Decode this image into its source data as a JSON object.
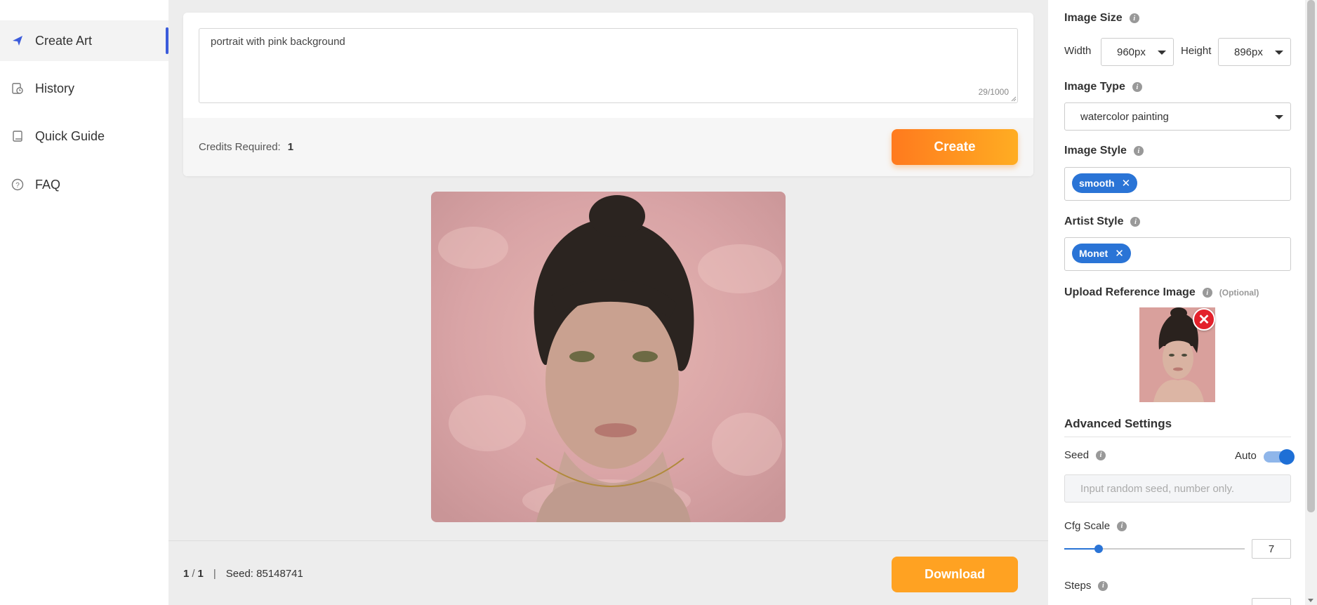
{
  "sidebar": {
    "items": [
      {
        "label": "Create Art",
        "icon": "send-icon",
        "active": true
      },
      {
        "label": "History",
        "icon": "history-icon"
      },
      {
        "label": "Quick Guide",
        "icon": "book-icon"
      },
      {
        "label": "FAQ",
        "icon": "question-icon"
      }
    ]
  },
  "prompt": {
    "value": "portrait with pink background",
    "counter": "29/1000"
  },
  "credits": {
    "label": "Credits Required:",
    "value": "1"
  },
  "create_label": "Create",
  "result": {
    "page_current": "1",
    "page_sep": "/",
    "page_total": "1",
    "divider": "|",
    "seed_text": "Seed: 85148741"
  },
  "download_label": "Download",
  "settings": {
    "image_size": {
      "label": "Image Size",
      "width_label": "Width",
      "width_value": "960px",
      "height_label": "Height",
      "height_value": "896px"
    },
    "image_type": {
      "label": "Image Type",
      "value": "watercolor painting"
    },
    "image_style": {
      "label": "Image Style",
      "tags": [
        "smooth"
      ]
    },
    "artist_style": {
      "label": "Artist Style",
      "tags": [
        "Monet"
      ]
    },
    "upload": {
      "label": "Upload Reference Image",
      "optional": "(Optional)"
    },
    "advanced": {
      "title": "Advanced Settings",
      "seed_label": "Seed",
      "auto_label": "Auto",
      "auto_on": true,
      "seed_placeholder": "Input random seed, number only.",
      "cfg_label": "Cfg Scale",
      "cfg_value": "7",
      "cfg_fraction": 0.19,
      "steps_label": "Steps"
    }
  },
  "colors": {
    "accent_orange": "#ffa222",
    "accent_blue": "#2a74d6",
    "active_bar": "#3b5bdb"
  }
}
